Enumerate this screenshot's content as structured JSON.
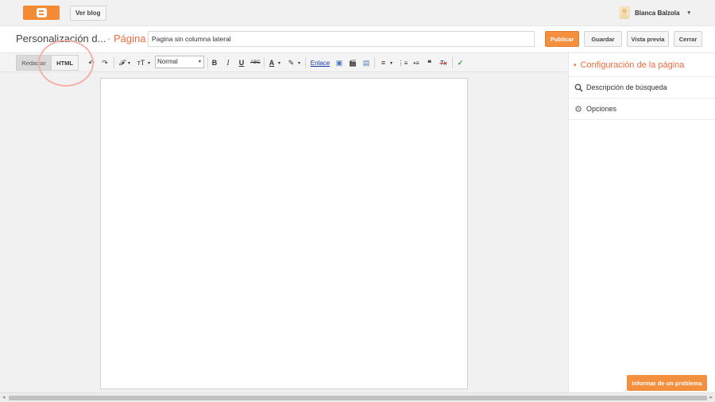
{
  "topbar": {
    "logo_icon": "blogger-logo-icon",
    "view_blog_label": "Ver blog",
    "user_name": "Blanca Balzola",
    "user_caret": "▾"
  },
  "title_row": {
    "blog_name": "Personalización d...",
    "page_type": "· Página",
    "title_value": "Pagina sin columna lateral",
    "publish_label": "Publicar",
    "save_label": "Guardar",
    "preview_label": "Vista previa",
    "close_label": "Cerrar"
  },
  "toolbar": {
    "compose_tab": "Redactar",
    "html_tab": "HTML",
    "undo": "↶",
    "redo": "↷",
    "font": "𝓕",
    "font_caret": "▾",
    "font_size": "тT",
    "size_caret": "▾",
    "format_value": "Normal",
    "format_caret": "▾",
    "bold": "B",
    "italic": "I",
    "underline": "U",
    "strike": "ABC",
    "text_color": "A",
    "text_color_caret": "▾",
    "highlight": "✎",
    "highlight_caret": "▾",
    "link": "Enlace",
    "image": "▣",
    "video": "🎬",
    "jump_break": "▤",
    "align": "≡",
    "align_caret": "▾",
    "numbered_list": "⋮≡",
    "bullet_list": "•≡",
    "quote": "❝",
    "clear_format": "Tx",
    "spellcheck": "✓"
  },
  "right_panel": {
    "header_label": "Configuración de la página",
    "header_caret": "▾",
    "items": [
      {
        "label": "Descripción de búsqueda",
        "icon": "search-icon",
        "glyph": "⚲"
      },
      {
        "label": "Opciones",
        "icon": "gear-icon",
        "glyph": "⚙"
      }
    ]
  },
  "report_label": "Informar de un problema",
  "scrollbar": {
    "left_arrow": "◂",
    "right_arrow": "▸"
  },
  "colors": {
    "accent": "#f48f3e",
    "page_label": "#ef6c3f",
    "highlight_circle": "#f3b2a7"
  }
}
